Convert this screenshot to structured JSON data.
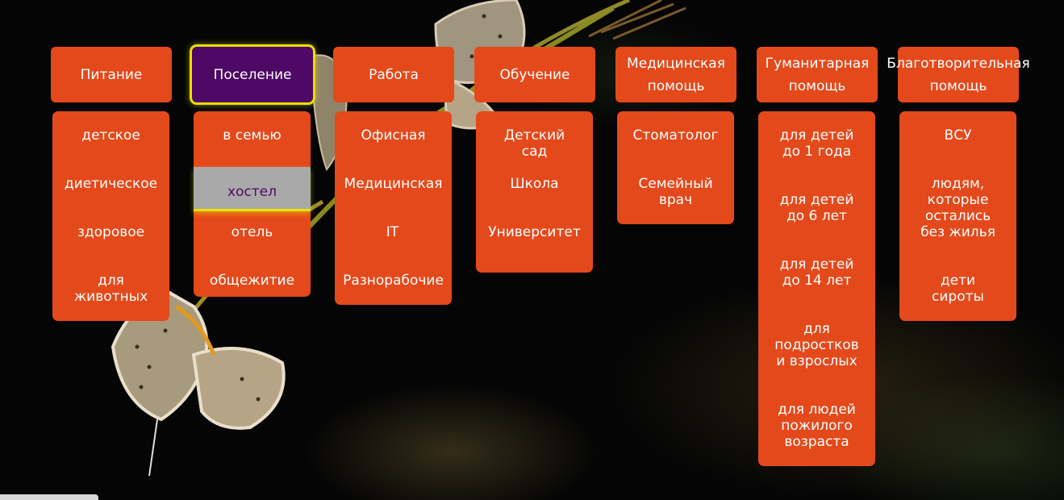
{
  "colors": {
    "menu_bg": "#e4491b",
    "active_bg": "#4e0866",
    "highlight_border": "#e8e000",
    "hover_item_bg": "#a9a9a9",
    "text": "#ffffff"
  },
  "menu": [
    {
      "label": "Питание",
      "items": [
        "детское",
        "диетическое",
        "здоровое",
        "для\nживотных"
      ]
    },
    {
      "label": "Поселение",
      "active": true,
      "items": [
        "в семью",
        "хостел",
        "отель",
        "общежитие"
      ],
      "hovered_item": "хостел"
    },
    {
      "label": "Работа",
      "items": [
        "Офисная",
        "Медицинская",
        "IT",
        "Разнорабочие"
      ]
    },
    {
      "label": "Обучение",
      "items": [
        "Детский\nсад",
        "Школа",
        "Университет"
      ]
    },
    {
      "label": "Медицинская\nпомощь",
      "items": [
        "Стоматолог",
        "Семейный\nврач"
      ]
    },
    {
      "label": "Гуманитарная\nпомощь",
      "items": [
        "для детей\nдо 1 года",
        "для детей\nдо 6 лет",
        "для детей\nдо 14 лет",
        "для\nподростков\nи взрослых",
        "для людей\nпожилого\nвозраста"
      ]
    },
    {
      "label": "Благотворительная\nпомощь",
      "items": [
        "ВСУ",
        "людям,\nкоторые\nостались\nбез жилья",
        "дети\nсироты"
      ]
    }
  ],
  "background": {
    "description_icon": "butterfly-photo"
  }
}
